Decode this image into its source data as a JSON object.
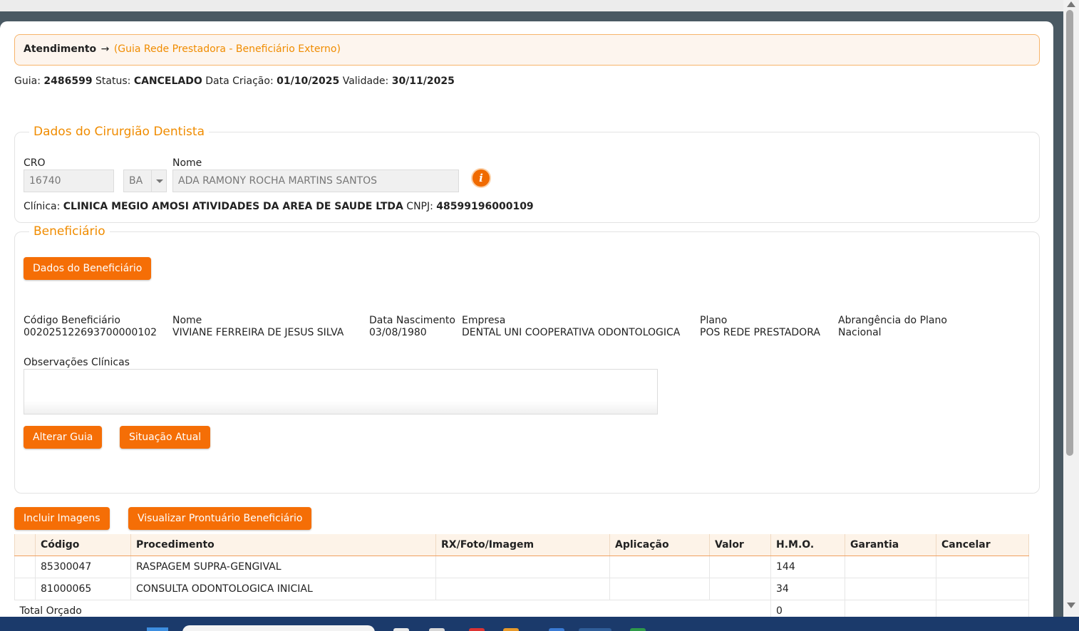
{
  "breadcrumb": {
    "root": "Atendimento",
    "arrow": "→",
    "sub": "(Guia Rede Prestadora - Beneficiário Externo)"
  },
  "guia": {
    "label": "Guia:",
    "number": "2486599",
    "status_label": "Status:",
    "status": "CANCELADO",
    "created_label": "Data Criação:",
    "created": "01/10/2025",
    "validity_label": "Validade:",
    "validity": "30/11/2025"
  },
  "dentist": {
    "legend": "Dados do Cirurgião Dentista",
    "cro_label": "CRO",
    "cro_value": "16740",
    "uf_value": "BA",
    "name_label": "Nome",
    "name_value": "ADA RAMONY ROCHA MARTINS SANTOS",
    "clinic_label": "Clínica:",
    "clinic_value": "CLINICA MEGIO AMOSI ATIVIDADES DA AREA DE SAUDE LTDA",
    "cnpj_label": "CNPJ:",
    "cnpj_value": "48599196000109",
    "info_icon": "i"
  },
  "beneficiary": {
    "legend": "Beneficiário",
    "data_button": "Dados do Beneficiário",
    "fields": [
      {
        "label": "Código Beneficiário",
        "value": "002025122693700000102"
      },
      {
        "label": "Nome",
        "value": "VIVIANE FERREIRA DE JESUS SILVA"
      },
      {
        "label": "Data Nascimento",
        "value": "03/08/1980"
      },
      {
        "label": "Empresa",
        "value": "DENTAL UNI COOPERATIVA ODONTOLOGICA"
      },
      {
        "label": "Plano",
        "value": "POS REDE PRESTADORA"
      },
      {
        "label": "Abrangência do Plano",
        "value": "Nacional"
      }
    ],
    "obs_label": "Observações Clínicas",
    "obs_value": "",
    "alter_button": "Alterar Guia",
    "situation_button": "Situação Atual"
  },
  "actions": {
    "images_button": "Incluir Imagens",
    "record_button": "Visualizar Prontuário Beneficiário"
  },
  "procedures": {
    "headers": [
      "",
      "Código",
      "Procedimento",
      "RX/Foto/Imagem",
      "Aplicação",
      "Valor",
      "H.M.O.",
      "Garantia",
      "Cancelar"
    ],
    "rows": [
      [
        "",
        "85300047",
        "RASPAGEM SUPRA-GENGIVAL",
        "",
        "",
        "",
        "144",
        "",
        ""
      ],
      [
        "",
        "81000065",
        "CONSULTA ODONTOLOGICA INICIAL",
        "",
        "",
        "",
        "34",
        "",
        ""
      ]
    ],
    "total_label": "Total Orçado",
    "total_hmo": "0"
  },
  "colors": {
    "accent": "#f56e06",
    "legend": "#f08c00",
    "frame": "#4a5963"
  }
}
